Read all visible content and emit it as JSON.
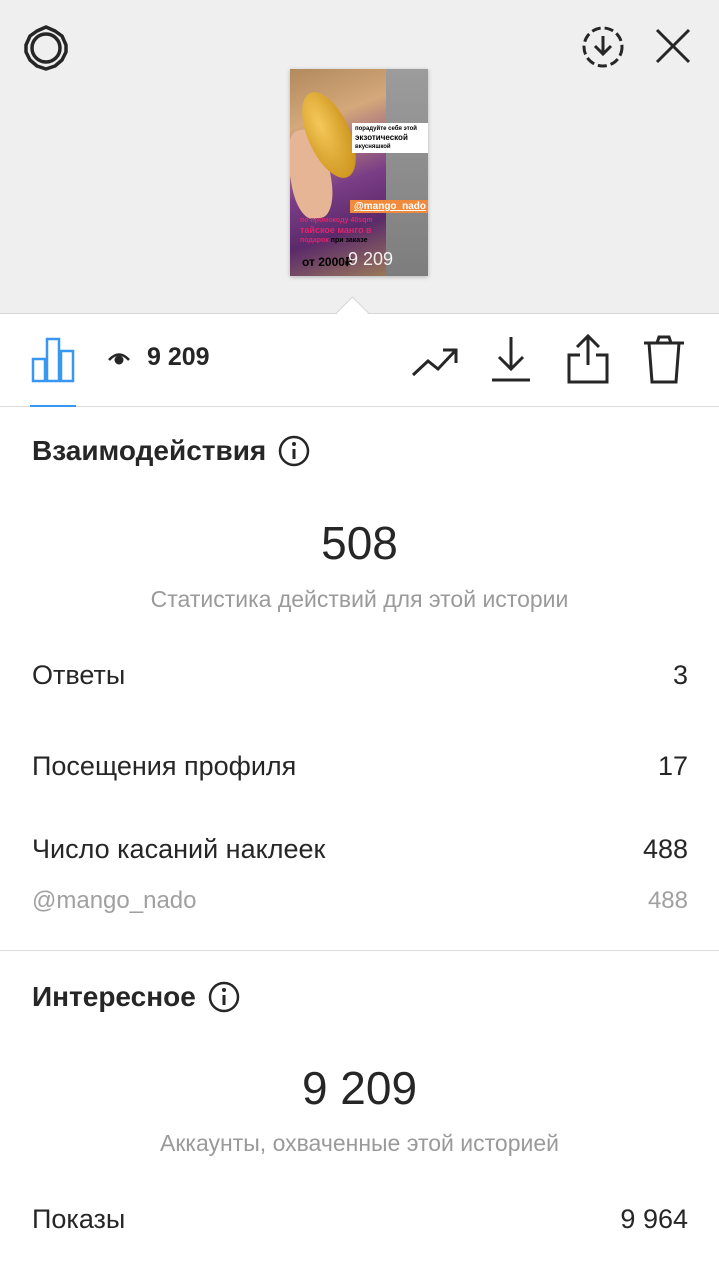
{
  "header": {
    "settings_icon": "gear-icon",
    "download_circle_icon": "download-circle-icon",
    "close_icon": "close-icon"
  },
  "story_preview": {
    "sticker_small": "порадуйте себя этой",
    "sticker_big": "экзотической",
    "sticker_end": "вкусняшкой",
    "mention_tag": "@mango_nado",
    "promo_line": "по промокоду 40sqm",
    "promo_big": "тайское манго в",
    "promo_end": "подарок",
    "promo_tail": "при заказе",
    "price": "от 2000₽",
    "overlay_count": "9 209"
  },
  "toolbar": {
    "views_count": "9 209",
    "icons": [
      "bar-chart-icon",
      "eye-icon",
      "trend-icon",
      "download-icon",
      "share-icon",
      "trash-icon"
    ]
  },
  "interactions": {
    "title": "Взаимодействия",
    "total": "508",
    "subtitle": "Статистика действий для этой истории",
    "rows": [
      {
        "label": "Ответы",
        "value": "3"
      },
      {
        "label": "Посещения профиля",
        "value": "17"
      },
      {
        "label": "Число касаний наклеек",
        "value": "488"
      }
    ],
    "sub_row": {
      "label": "@mango_nado",
      "value": "488"
    }
  },
  "discovery": {
    "title": "Интересное",
    "total": "9 209",
    "subtitle": "Аккаунты, охваченные этой историей",
    "rows": [
      {
        "label": "Показы",
        "value": "9 964"
      }
    ]
  },
  "colors": {
    "accent": "#3897f0",
    "text": "#262626",
    "muted": "#9a9a9a",
    "top_bg": "#efefef"
  }
}
